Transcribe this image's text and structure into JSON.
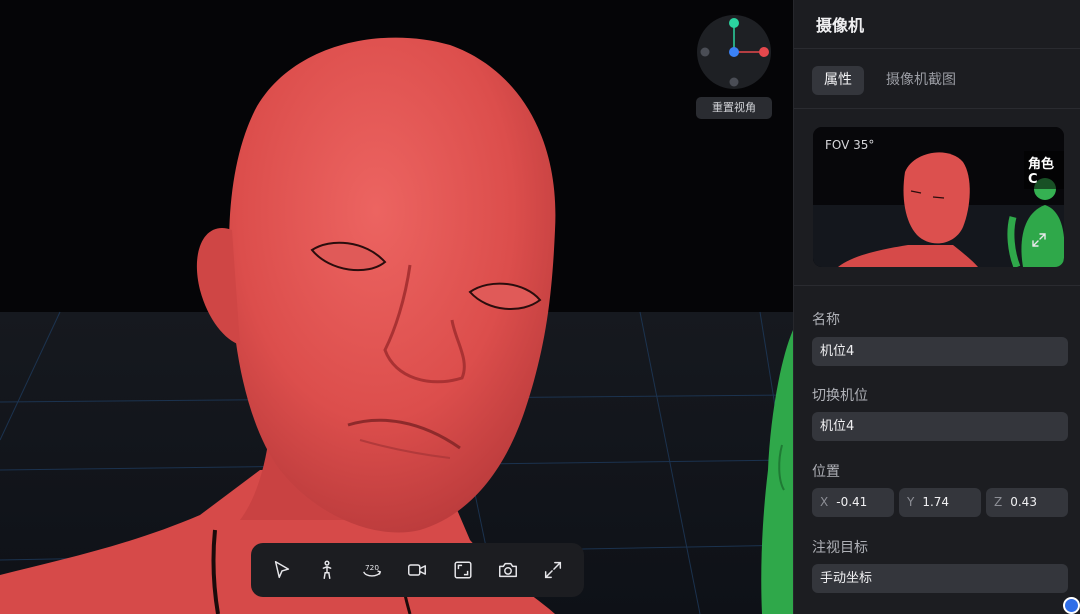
{
  "viewport": {
    "reset_view_label": "重置视角",
    "gizmo_axes": {
      "x_color": "#e5484d",
      "y_color": "#2bd4a0",
      "z_color": "#3b82f6"
    }
  },
  "toolbar": {
    "items": [
      {
        "name": "select-tool",
        "icon": "cursor-arrow-icon"
      },
      {
        "name": "pose-tool",
        "icon": "person-icon"
      },
      {
        "name": "rotate-720-tool",
        "icon": "rotate-720-icon",
        "label": "720"
      },
      {
        "name": "camera-tool",
        "icon": "video-camera-icon"
      },
      {
        "name": "frame-tool",
        "icon": "frame-icon"
      },
      {
        "name": "screenshot-tool",
        "icon": "camera-icon"
      },
      {
        "name": "fullscreen-tool",
        "icon": "expand-icon"
      }
    ]
  },
  "panel": {
    "title": "摄像机",
    "tabs": [
      {
        "label": "属性",
        "active": true
      },
      {
        "label": "摄像机截图",
        "active": false
      }
    ],
    "preview": {
      "fov_label": "FOV 35°",
      "character_label": "角色C"
    },
    "name": {
      "label": "名称",
      "value": "机位4"
    },
    "switch_camera": {
      "label": "切换机位",
      "value": "机位4"
    },
    "position": {
      "label": "位置",
      "x": {
        "axis": "X",
        "value": "-0.41"
      },
      "y": {
        "axis": "Y",
        "value": "1.74"
      },
      "z": {
        "axis": "Z",
        "value": "0.43"
      }
    },
    "look_target": {
      "label": "注视目标",
      "value": "手动坐标"
    }
  },
  "colors": {
    "accent_red_model": "#e0504f",
    "green_model": "#2fa84a",
    "panel_bg": "#1c1d21",
    "field_bg": "#34363c"
  }
}
